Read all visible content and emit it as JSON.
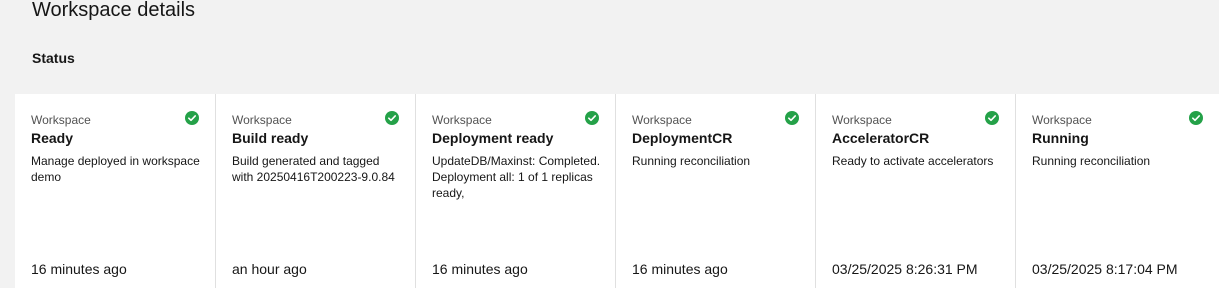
{
  "page": {
    "title": "Workspace details",
    "section_title": "Status"
  },
  "colors": {
    "success": "#24a148",
    "background": "#f2f2f2",
    "card": "#ffffff"
  },
  "cards": [
    {
      "label": "Workspace",
      "status": "Ready",
      "description": "Manage deployed in workspace demo",
      "time": "16 minutes ago",
      "icon": "checkmark-filled-icon"
    },
    {
      "label": "Workspace",
      "status": "Build ready",
      "description": "Build generated and tagged with 20250416T200223-9.0.84",
      "time": "an hour ago",
      "icon": "checkmark-filled-icon"
    },
    {
      "label": "Workspace",
      "status": "Deployment ready",
      "description": "UpdateDB/Maxinst: Completed. Deployment all: 1 of 1 replicas ready,",
      "time": "16 minutes ago",
      "icon": "checkmark-filled-icon"
    },
    {
      "label": "Workspace",
      "status": "DeploymentCR",
      "description": "Running reconciliation",
      "time": "16 minutes ago",
      "icon": "checkmark-filled-icon"
    },
    {
      "label": "Workspace",
      "status": "AcceleratorCR",
      "description": "Ready to activate accelerators",
      "time": "03/25/2025 8:26:31 PM",
      "icon": "checkmark-filled-icon"
    },
    {
      "label": "Workspace",
      "status": "Running",
      "description": "Running reconciliation",
      "time": "03/25/2025 8:17:04 PM",
      "icon": "checkmark-filled-icon"
    }
  ]
}
